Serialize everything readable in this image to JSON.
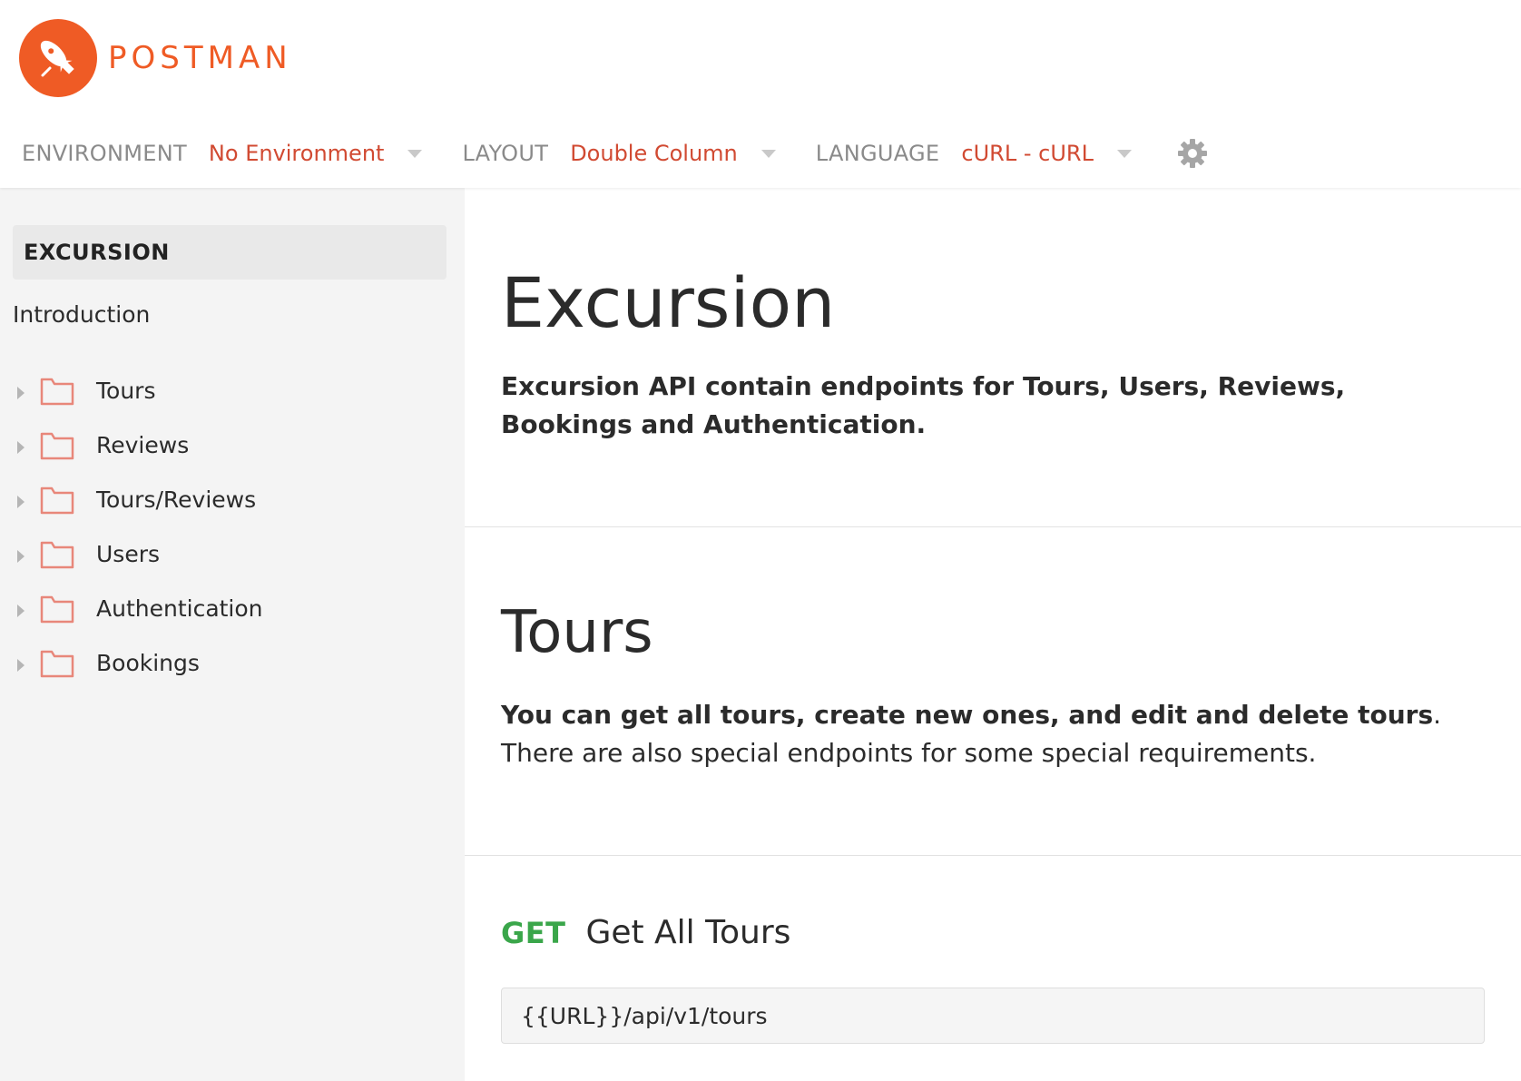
{
  "brand": {
    "name": "POSTMAN",
    "color": "#ef5b25"
  },
  "toolbar": {
    "environment_label": "ENVIRONMENT",
    "environment_value": "No Environment",
    "layout_label": "LAYOUT",
    "layout_value": "Double Column",
    "language_label": "LANGUAGE",
    "language_value": "cURL - cURL",
    "settings_icon": "gear-icon"
  },
  "sidebar": {
    "collection_title": "EXCURSION",
    "intro_link": "Introduction",
    "items": [
      {
        "label": "Tours"
      },
      {
        "label": "Reviews"
      },
      {
        "label": "Tours/Reviews"
      },
      {
        "label": "Users"
      },
      {
        "label": "Authentication"
      },
      {
        "label": "Bookings"
      }
    ]
  },
  "main": {
    "title": "Excursion",
    "description": "Excursion API contain endpoints for Tours, Users, Reviews, Bookings and Authentication.",
    "section_title": "Tours",
    "section_desc_bold": "You can get all tours, create new ones, and edit and delete tours",
    "section_desc_rest": ". There are also special endpoints for some special requirements.",
    "endpoint": {
      "method": "GET",
      "name": "Get All Tours",
      "url": "{{URL}}/api/v1/tours"
    }
  },
  "colors": {
    "accent": "#d14a32",
    "get_method": "#3aa64a",
    "sidebar_bg": "#f4f4f4"
  }
}
